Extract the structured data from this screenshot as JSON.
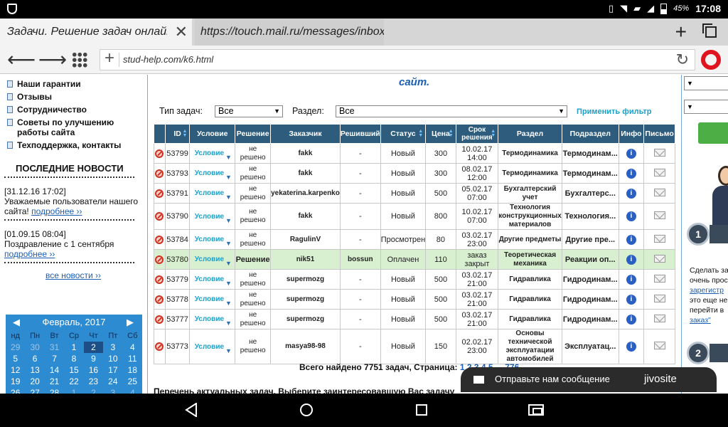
{
  "status": {
    "battery": "45%",
    "time": "17:08"
  },
  "browser": {
    "tab1": "Задачи. Решение задач онлайн",
    "tab2": "https://touch.mail.ru/messages/inbox",
    "url": "stud-help.com/k6.html"
  },
  "sidebar": {
    "menu": [
      "Наши гарантии",
      "Отзывы",
      "Сотрудничество",
      "Советы по улучшению работы сайта",
      "Техподдержка, контакты"
    ],
    "news_title": "ПОСЛЕДНИЕ НОВОСТИ",
    "news1_date": "[31.12.16 17:02]",
    "news1_text": "Уважаемые пользователи нашего сайта!",
    "news1_more": "подробнее ››",
    "news2_date": "[01.09.15 08:04]",
    "news2_text": "Поздравление с 1 сентября",
    "news2_more": "подробнее ››",
    "all_news": "все новости ››"
  },
  "calendar": {
    "month": "Февраль, 2017",
    "dow": [
      "нд",
      "Пн",
      "Вт",
      "Ср",
      "Чт",
      "Пт",
      "Сб"
    ],
    "days": [
      {
        "d": "29",
        "o": true
      },
      {
        "d": "30",
        "o": true
      },
      {
        "d": "31",
        "o": true
      },
      {
        "d": "1"
      },
      {
        "d": "2",
        "t": true
      },
      {
        "d": "3"
      },
      {
        "d": "4"
      },
      {
        "d": "5"
      },
      {
        "d": "6"
      },
      {
        "d": "7"
      },
      {
        "d": "8"
      },
      {
        "d": "9"
      },
      {
        "d": "10"
      },
      {
        "d": "11"
      },
      {
        "d": "12"
      },
      {
        "d": "13"
      },
      {
        "d": "14"
      },
      {
        "d": "15"
      },
      {
        "d": "16"
      },
      {
        "d": "17"
      },
      {
        "d": "18"
      },
      {
        "d": "19"
      },
      {
        "d": "20"
      },
      {
        "d": "21"
      },
      {
        "d": "22"
      },
      {
        "d": "23"
      },
      {
        "d": "24"
      },
      {
        "d": "25"
      },
      {
        "d": "26"
      },
      {
        "d": "27"
      },
      {
        "d": "28"
      },
      {
        "d": "1",
        "o": true
      },
      {
        "d": "2",
        "o": true
      },
      {
        "d": "3",
        "o": true
      },
      {
        "d": "4",
        "o": true
      }
    ]
  },
  "main": {
    "site_word": "сайт.",
    "filter_label": "Тип задач:",
    "filter_value": "Все",
    "section_label": "Раздел:",
    "section_value": "Все",
    "apply": "Применить фильтр",
    "total": "Всего найдено 7751 задач, Страница: ",
    "pages": "1 2 3 4 5 ... 776",
    "perechen": "Перечень актуальных задач. Выберите заинтересовавшую Вас задачу"
  },
  "table": {
    "headers": [
      "",
      "ID",
      "Условие",
      "Решение",
      "Заказчик",
      "Решивший",
      "Статус",
      "Цена",
      "Срок решения",
      "Раздел",
      "Подраздел",
      "Инфо",
      "Письмо"
    ],
    "rows": [
      {
        "id": "53799",
        "cond": "Условие",
        "sol": "не решено",
        "cust": "fakk",
        "solver": "-",
        "status": "Новый",
        "price": "300",
        "due": "10.02.17 14:00",
        "sec": "Термодинамика",
        "sub": "Термодинам..."
      },
      {
        "id": "53793",
        "cond": "Условие",
        "sol": "не решено",
        "cust": "fakk",
        "solver": "-",
        "status": "Новый",
        "price": "300",
        "due": "08.02.17 12:00",
        "sec": "Термодинамика",
        "sub": "Термодинам..."
      },
      {
        "id": "53791",
        "cond": "Условие",
        "sol": "не решено",
        "cust": "yekaterina.karpenko",
        "solver": "-",
        "status": "Новый",
        "price": "500",
        "due": "05.02.17 07:00",
        "sec": "Бухгалтерский учет",
        "sub": "Бухгалтерс..."
      },
      {
        "id": "53790",
        "cond": "Условие",
        "sol": "не решено",
        "cust": "fakk",
        "solver": "-",
        "status": "Новый",
        "price": "800",
        "due": "10.02.17 07:00",
        "sec": "Технология конструкционных материалов",
        "sub": "Технология..."
      },
      {
        "id": "53784",
        "cond": "Условие",
        "sol": "не решено",
        "cust": "RagulinV",
        "solver": "-",
        "status": "Просмотрен",
        "price": "80",
        "due": "03.02.17 23:00",
        "sec": "Другие предметы",
        "sub": "Другие пре..."
      },
      {
        "id": "53780",
        "cond": "Условие",
        "sol": "Решение",
        "cust": "nik51",
        "solver": "bossun",
        "status": "Оплачен",
        "price": "110",
        "due": "заказ закрыт",
        "sec": "Теоретическая механика",
        "sub": "Реакции оп..."
      },
      {
        "id": "53779",
        "cond": "Условие",
        "sol": "не решено",
        "cust": "supermozg",
        "solver": "-",
        "status": "Новый",
        "price": "500",
        "due": "03.02.17 21:00",
        "sec": "Гидравлика",
        "sub": "Гидродинам..."
      },
      {
        "id": "53778",
        "cond": "Условие",
        "sol": "не решено",
        "cust": "supermozg",
        "solver": "-",
        "status": "Новый",
        "price": "500",
        "due": "03.02.17 21:00",
        "sec": "Гидравлика",
        "sub": "Гидродинам..."
      },
      {
        "id": "53777",
        "cond": "Условие",
        "sol": "не решено",
        "cust": "supermozg",
        "solver": "-",
        "status": "Новый",
        "price": "500",
        "due": "03.02.17 21:00",
        "sec": "Гидравлика",
        "sub": "Гидродинам..."
      },
      {
        "id": "53773",
        "cond": "Условие",
        "sol": "не решено",
        "cust": "masya98-98",
        "solver": "-",
        "status": "Новый",
        "price": "150",
        "due": "02.02.17 23:00",
        "sec": "Основы технической эксплуатации автомобилей",
        "sub": "Эксплуатац..."
      }
    ]
  },
  "rightpanel": {
    "step1": "1",
    "step2": "2",
    "text_a": "Сделать за",
    "text_b": "очень прос",
    "link_register": "зарегистр",
    "text_c": "это еще не",
    "text_d": "перейти в",
    "link_order": "заказ\""
  },
  "jivo": {
    "label": "Отправьте нам сообщение",
    "brand": "jivosite"
  }
}
